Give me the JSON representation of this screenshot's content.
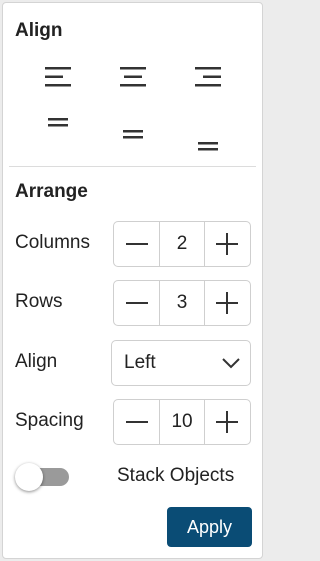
{
  "align": {
    "title": "Align",
    "buttons": [
      {
        "icon": "align-left-icon"
      },
      {
        "icon": "align-center-icon"
      },
      {
        "icon": "align-right-icon"
      },
      {
        "icon": "align-top-icon"
      },
      {
        "icon": "align-middle-icon"
      },
      {
        "icon": "align-bottom-icon"
      }
    ]
  },
  "arrange": {
    "title": "Arrange",
    "columns": {
      "label": "Columns",
      "value": "2"
    },
    "rows": {
      "label": "Rows",
      "value": "3"
    },
    "align": {
      "label": "Align",
      "value": "Left"
    },
    "spacing": {
      "label": "Spacing",
      "value": "10"
    },
    "stack": {
      "label": "Stack Objects",
      "enabled": false
    },
    "apply_label": "Apply"
  },
  "colors": {
    "accent": "#0a4c75",
    "icon": "#333333",
    "toggle_off": "#9a9a9a"
  }
}
